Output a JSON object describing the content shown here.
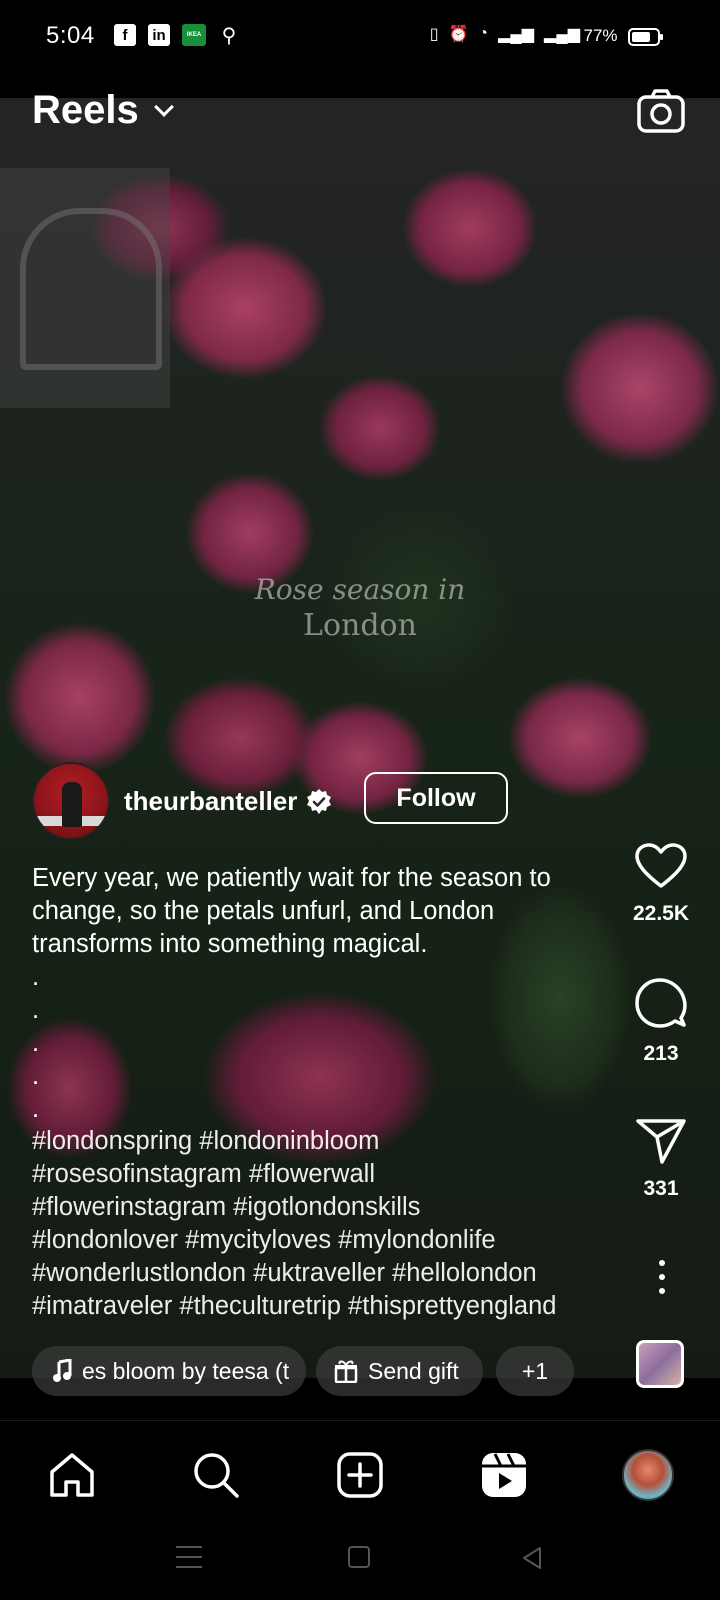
{
  "status_bar": {
    "time": "5:04",
    "apps": [
      "facebook",
      "linkedin",
      "ikea",
      "location"
    ],
    "app_labels": {
      "facebook": "f",
      "linkedin": "in",
      "ikea": "IKEA"
    },
    "battery": "77%",
    "battery_level": 0.77
  },
  "header": {
    "title": "Reels"
  },
  "reel": {
    "overlay_line1": "Rose season in",
    "overlay_line2": "London",
    "creator": {
      "username": "theurbanteller",
      "verified": true,
      "follow_label": "Follow"
    },
    "caption": "Every year, we patiently wait for the season to change, so the petals unfurl, and London transforms into something magical.",
    "caption_dots": [
      ".",
      ".",
      ".",
      ".",
      "."
    ],
    "hashtags": "#londonspring #londoninbloom\n#rosesofinstagram #flowerwall\n#flowerinstagram #igotlondonskills\n#londonlover #mycityloves #mylondonlife\n#wonderlustlondon #uktraveller #hellolondon\n#imatraveler #theculturetrip #thisprettyengland",
    "actions": {
      "likes": "22.5K",
      "comments": "213",
      "shares": "331"
    },
    "pills": {
      "music": "es bloom by teesa (t",
      "gift": "Send gift",
      "more": "+1"
    }
  },
  "bottom_nav": {
    "items": [
      "home",
      "search",
      "create",
      "reels",
      "profile"
    ],
    "active": "reels"
  },
  "colors": {
    "background": "#000000",
    "text": "#ffffff"
  }
}
